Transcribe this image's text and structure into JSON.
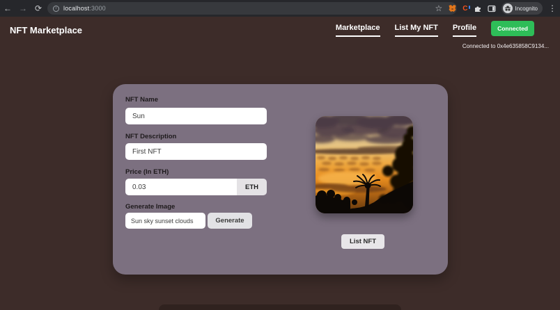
{
  "colors": {
    "page_bg": "#3d2c29",
    "card_bg": "#7c7080",
    "accent_green": "#2ebd58",
    "button_gray": "#e2e2e5",
    "toolbar_bg": "#26272b"
  },
  "browser": {
    "url_host": "localhost",
    "url_port": ":3000",
    "incognito_label": "Incognito",
    "extension_c_letter": "C",
    "icons": {
      "back": "←",
      "forward": "→",
      "reload": "⟳",
      "star": "☆",
      "menu": "⋮",
      "info": "i"
    }
  },
  "header": {
    "title": "NFT Marketplace",
    "nav": [
      {
        "label": "Marketplace"
      },
      {
        "label": "List My NFT"
      },
      {
        "label": "Profile"
      }
    ],
    "connect_button": "Connected",
    "wallet_status": "Connected to 0x4e635858C9134..."
  },
  "form": {
    "name_label": "NFT Name",
    "name_value": "Sun",
    "description_label": "NFT Description",
    "description_value": "First NFT",
    "price_label": "Price (In ETH)",
    "price_value": "0.03",
    "price_addon": "ETH",
    "generate_label": "Generate Image",
    "generate_value": "Sun sky sunset clouds",
    "generate_button": "Generate",
    "list_button": "List NFT"
  }
}
